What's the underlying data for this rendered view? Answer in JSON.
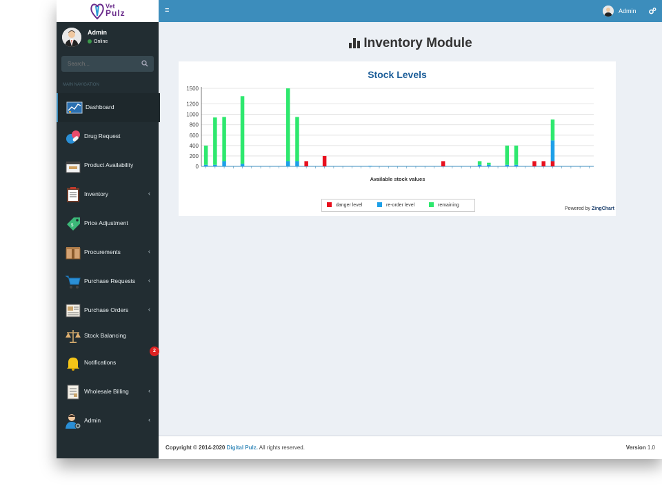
{
  "app": {
    "logo_line1": "Vet",
    "logo_line2": "Pulz"
  },
  "user": {
    "name": "Admin",
    "status": "Online"
  },
  "sidebar": {
    "search_placeholder": "Search...",
    "header": "MAIN NAVIGATION",
    "items": [
      {
        "label": "Dashboard",
        "icon": "dashboard-icon",
        "chevron": ""
      },
      {
        "label": "Drug Request",
        "icon": "pills-icon",
        "chevron": ""
      },
      {
        "label": "Product Availability",
        "icon": "box-icon",
        "chevron": ""
      },
      {
        "label": "Inventory",
        "icon": "clipboard-icon",
        "chevron": "‹"
      },
      {
        "label": "Price Adjustment",
        "icon": "price-tag-icon",
        "chevron": ""
      },
      {
        "label": "Procurements",
        "icon": "package-icon",
        "chevron": "‹"
      },
      {
        "label": "Purchase Requests",
        "icon": "cart-icon",
        "chevron": "‹"
      },
      {
        "label": "Purchase Orders",
        "icon": "order-icon",
        "chevron": "‹"
      },
      {
        "label": "Stock Balancing",
        "icon": "scales-icon",
        "chevron": ""
      },
      {
        "label": "Notifications",
        "icon": "bell-icon",
        "chevron": ""
      },
      {
        "label": "Wholesale Billing",
        "icon": "bill-icon",
        "chevron": "‹"
      },
      {
        "label": "Admin",
        "icon": "admin-user-icon",
        "chevron": "‹"
      }
    ],
    "notification_badge": "2"
  },
  "topbar": {
    "menu_icon": "≡",
    "user_name": "Admin"
  },
  "main": {
    "title": "Inventory Module"
  },
  "chart_data": {
    "type": "bar",
    "title": "Stock Levels",
    "xlabel": "Available stock values",
    "ylabel": "",
    "ylim": [
      0,
      1500
    ],
    "yticks": [
      "0",
      "200",
      "400",
      "600",
      "800",
      "1000",
      "1200",
      "1500"
    ],
    "stacked": true,
    "legend_position": "bottom",
    "grid": true,
    "categories_count": 43,
    "series": [
      {
        "name": "danger level",
        "color": "#e8101e",
        "values": [
          0,
          0,
          0,
          0,
          0,
          0,
          0,
          0,
          0,
          0,
          0,
          100,
          0,
          200,
          0,
          0,
          0,
          0,
          0,
          0,
          0,
          0,
          0,
          0,
          0,
          0,
          100,
          0,
          0,
          0,
          0,
          0,
          0,
          0,
          0,
          0,
          100,
          100,
          100,
          0,
          0,
          0,
          0
        ]
      },
      {
        "name": "re-order level",
        "color": "#1ea0e8",
        "values": [
          30,
          30,
          100,
          0,
          50,
          0,
          0,
          0,
          0,
          100,
          100,
          0,
          0,
          0,
          0,
          0,
          0,
          0,
          10,
          0,
          0,
          0,
          0,
          0,
          0,
          0,
          0,
          0,
          0,
          0,
          30,
          30,
          0,
          30,
          30,
          0,
          0,
          0,
          400,
          0,
          0,
          0,
          0
        ]
      },
      {
        "name": "remaining",
        "color": "#2ee86e",
        "values": [
          370,
          910,
          850,
          0,
          1300,
          0,
          0,
          0,
          0,
          1400,
          850,
          0,
          0,
          0,
          0,
          0,
          0,
          0,
          0,
          0,
          0,
          0,
          0,
          0,
          0,
          0,
          0,
          0,
          0,
          0,
          70,
          40,
          0,
          370,
          370,
          0,
          0,
          0,
          400,
          0,
          0,
          0,
          0
        ]
      }
    ]
  },
  "chart_footer": {
    "powered_prefix": "Powered by",
    "powered_brand": "ZingChart"
  },
  "footer": {
    "copyright_prefix": "Copyright © 2014-2020",
    "company": "Digital Pulz.",
    "rights": "All rights reserved.",
    "version_label": "Version",
    "version_value": "1.0"
  },
  "colors": {
    "sidebar_bg": "#222d32",
    "topbar_bg": "#3c8dbc",
    "content_bg": "#ecf0f5",
    "chart_title": "#1d5e99"
  }
}
